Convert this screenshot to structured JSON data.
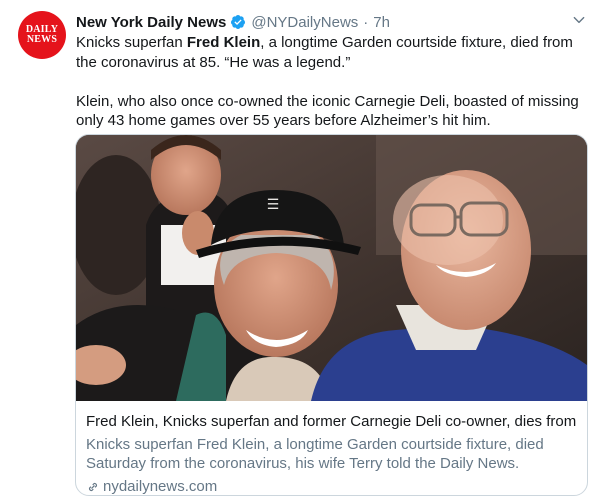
{
  "avatar": {
    "line1": "DAILY",
    "line2": "NEWS",
    "color": "#e5131b"
  },
  "header": {
    "name": "New York Daily News",
    "handle": "@NYDailyNews",
    "separator": "·",
    "time": "7h",
    "verified_icon": "verified-badge-icon",
    "menu_icon": "chevron-down-icon"
  },
  "tweet": {
    "p1_pre": "Knicks superfan ",
    "p1_bold": "Fred Klein",
    "p1_post": ", a longtime Garden courtside fixture, died from the coronavirus at 85. “He was a legend.”",
    "p2": "Klein, who also once co-owned the iconic Carnegie Deli, boasted of missing only 43 home games over 55 years before Alzheimer’s hit him."
  },
  "card": {
    "title": "Fred Klein, Knicks superfan and former Carnegie Deli co-owner, dies from ...",
    "description": "Knicks superfan Fred Klein, a longtime Garden courtside fixture, died Saturday from the coronavirus, his wife Terry told the Daily News.",
    "domain": "nydailynews.com",
    "link_icon": "link-icon"
  },
  "colors": {
    "text": "#14171a",
    "secondary": "#657786",
    "border": "#ccd6dd",
    "verified": "#1da1f2"
  }
}
